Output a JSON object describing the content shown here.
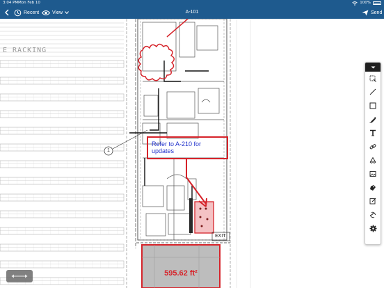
{
  "status_bar": {
    "time": "3:04 PM",
    "date": "Mon Feb 10",
    "battery": "100%",
    "icons": [
      "wifi-icon",
      "battery-icon"
    ]
  },
  "nav": {
    "back_icon": "chevron-left-icon",
    "recent_label": "Recent",
    "view_label": "View",
    "title": "A-101",
    "send_label": "Send"
  },
  "drawing": {
    "racking_label": "E RACKING",
    "callout_text": "Refer to A-210 for updates",
    "area_text": "595.62 ft²",
    "exit_label": "EXIT",
    "bubble_label": "1"
  },
  "toolbar": {
    "tools": [
      "collapse-icon",
      "selection-icon",
      "line-tool-icon",
      "rectangle-tool-icon",
      "highlighter-icon",
      "text-tool-icon",
      "link-tool-icon",
      "cloud-tool-icon",
      "image-tool-icon",
      "stamp-tool-icon",
      "edit-tool-icon",
      "rotate-icon",
      "settings-icon"
    ]
  },
  "colors": {
    "nav_bg": "#1e5a8e",
    "markup_red": "#d6232a",
    "callout_text": "#2233cc",
    "area_fill": "#bdbdbd"
  }
}
